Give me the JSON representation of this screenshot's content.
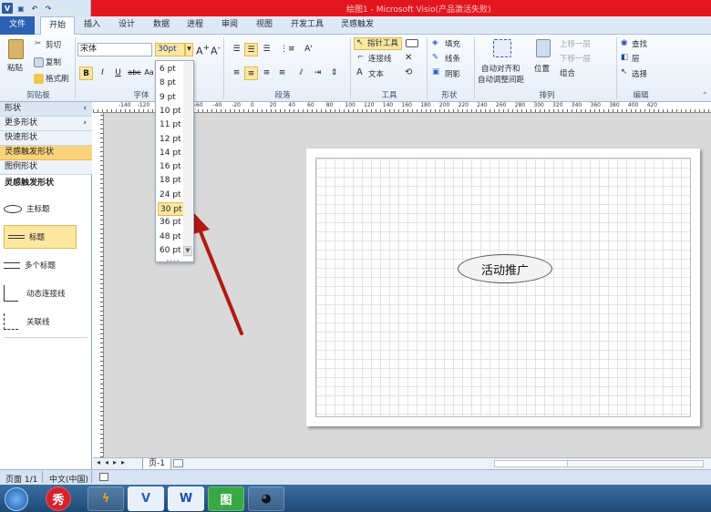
{
  "window": {
    "title": "绘图1 - Microsoft Visio(产品激活失败)"
  },
  "qat": {
    "logo": "V",
    "save": "▣",
    "undo": "↶",
    "redo": "↷"
  },
  "tabs": [
    "文件",
    "开始",
    "插入",
    "设计",
    "数据",
    "进程",
    "审阅",
    "视图",
    "开发工具",
    "灵感触发"
  ],
  "ribbon": {
    "clipboard": {
      "paste": "粘贴",
      "cut": "剪切",
      "copy": "复制",
      "format_painter": "格式刷",
      "label": "剪贴板"
    },
    "font": {
      "name": "宋体",
      "size": "30pt",
      "bold": "B",
      "italic": "I",
      "underline": "U",
      "strike": "abc",
      "case": "Aa",
      "label": "字体"
    },
    "paragraph": {
      "label": "段落"
    },
    "tools": {
      "pointer": "指针工具",
      "connector": "连接线",
      "text": "文本",
      "label": "工具"
    },
    "shape": {
      "fill": "填充",
      "line": "线条",
      "shadow": "阴影",
      "label": "形状"
    },
    "arrange": {
      "auto_align": "自动对齐和",
      "auto_space": "自动调整间距",
      "position": "位置",
      "bring_forward": "上移一层",
      "send_backward": "下移一层",
      "group": "组合",
      "label": "排列"
    },
    "edit": {
      "find": "查找",
      "layer": "层",
      "select": "选择",
      "label": "编辑"
    }
  },
  "font_size_menu": {
    "options": [
      "6 pt",
      "8 pt",
      "9 pt",
      "10 pt",
      "11 pt",
      "12 pt",
      "14 pt",
      "16 pt",
      "18 pt",
      "24 pt",
      "30 pt",
      "36 pt",
      "48 pt",
      "60 pt"
    ],
    "selected": "30 pt"
  },
  "shapes_panel": {
    "header": "形状",
    "more": "更多形状",
    "quick": "快速形状",
    "stencil": "灵感触发形状",
    "legend": "图例形状",
    "stencil_title": "灵感触发形状",
    "items": [
      "主标题",
      "标题",
      "多个标题",
      "动态连接线",
      "关联线"
    ]
  },
  "ruler_labels": [
    "-140",
    "-120",
    "-100",
    "-80",
    "-60",
    "-40",
    "-20",
    "0",
    "20",
    "40",
    "60",
    "80",
    "100",
    "120",
    "140",
    "160",
    "180",
    "200",
    "220",
    "240",
    "260",
    "280",
    "300",
    "320",
    "340",
    "360",
    "380",
    "400",
    "420"
  ],
  "canvas": {
    "shape_text": "活动推广"
  },
  "page_tab": "页-1",
  "status": {
    "page": "页面 1/1",
    "language": "中文(中国)"
  },
  "taskbar": {
    "apps": [
      "秀",
      "",
      "V",
      "W",
      "图",
      ""
    ]
  },
  "colors": {
    "title_bar": "#e3151e",
    "file_tab": "#2b62b2",
    "highlight": "#fde7a1",
    "arrow": "#b01a12"
  }
}
